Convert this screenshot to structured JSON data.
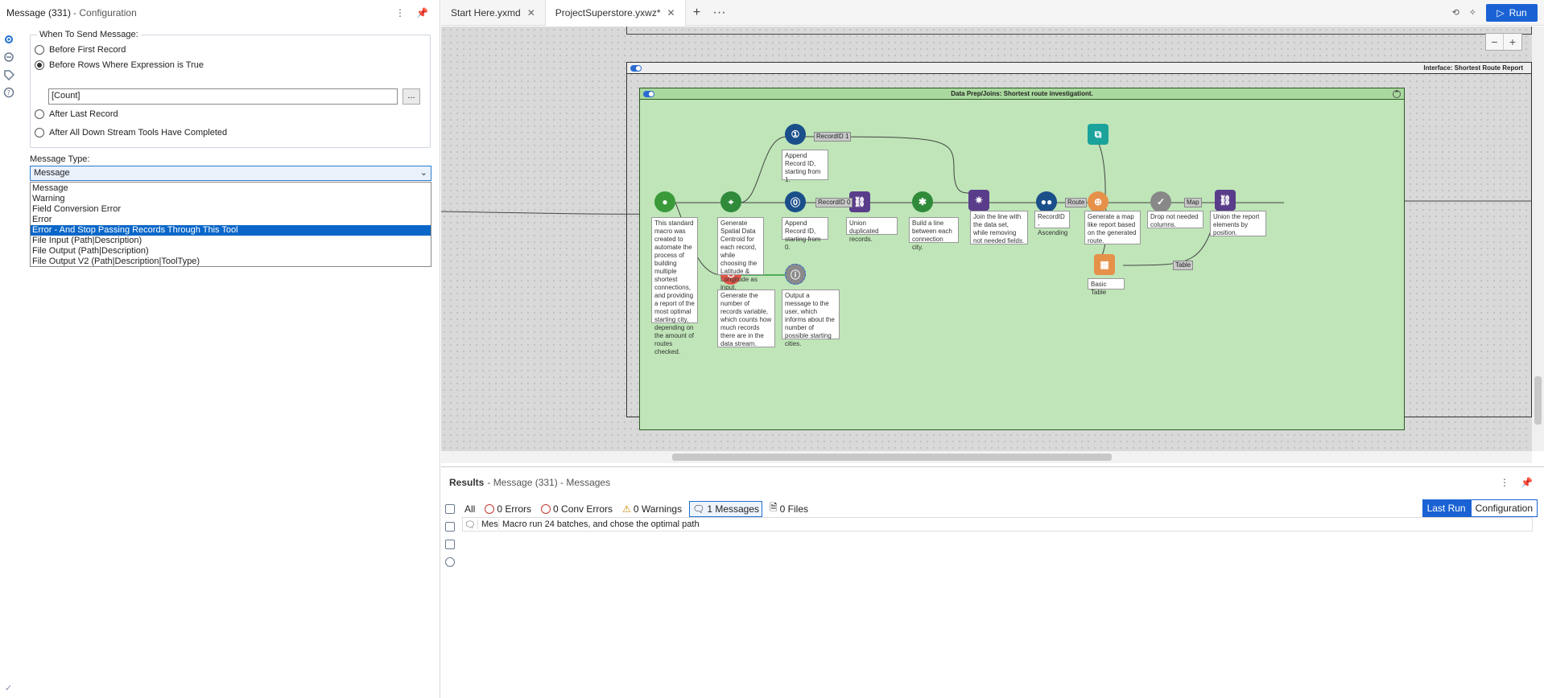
{
  "config_panel": {
    "title": "Message (331)",
    "subtitle": "- Configuration",
    "when_group_label": "When To Send Message:",
    "radio_options": [
      {
        "label": "Before First Record",
        "selected": false
      },
      {
        "label": "Before Rows Where Expression is True",
        "selected": true
      },
      {
        "label": "After Last Record",
        "selected": false
      },
      {
        "label": "After All Down Stream Tools Have Completed",
        "selected": false
      }
    ],
    "expression_value": "[Count]",
    "expression_button": "...",
    "message_type_label": "Message Type:",
    "message_type_selected": "Message",
    "message_type_options": [
      "Message",
      "Warning",
      "Field Conversion Error",
      "Error",
      "Error - And Stop Passing Records Through This Tool",
      "File Input (Path|Description)",
      "File Output (Path|Description)",
      "File Output V2 (Path|Description|ToolType)"
    ],
    "highlighted_option_index": 4
  },
  "tabs": [
    {
      "label": "Start Here.yxmd",
      "active": false
    },
    {
      "label": "ProjectSuperstore.yxwz*",
      "active": true
    }
  ],
  "toolbar": {
    "add_tab": "+",
    "more": "···",
    "run_label": "Run"
  },
  "canvas": {
    "interface_title": "Interface: Shortest Route Report",
    "container_title": "Data Prep/Joins: Shortest route investigationt.",
    "connection_labels": {
      "record_id_1": "RecordID 1",
      "record_id_0": "RecordID 0",
      "route": "Route",
      "map": "Map",
      "table": "Table"
    },
    "annotations": {
      "macro": "This standard macro was created to automate the process of building multiple shortest connections, and providing a report of the most optimal starting city, depending on the amount of routes checked.",
      "spatial": "Generate Spatial Data Centroid for each record, while choosing the Latitude & Longitude as input.",
      "append1": "Append Record ID, starting from 1.",
      "append0": "Append Record ID, starting from 0.",
      "union_dup": "Union duplicated records.",
      "build_line": "Build a line between each connection city.",
      "join": "Join the line with the data set, while removing not needed fields.",
      "sort": "RecordID - Ascending",
      "map": "Generate a map like report based on the generated route.",
      "drop": "Drop not needed columns.",
      "union_report": "Union the report elements by position.",
      "basic_table": "Basic Table",
      "count": "Generate the number of records variable, which counts how much records there are in the data stream.",
      "message": "Output a message to the user, which informs about the number of possible starting cities."
    },
    "zoom_out": "−",
    "zoom_in": "+"
  },
  "results": {
    "title": "Results",
    "subtitle": "- Message (331) - Messages",
    "filters": {
      "all": "All",
      "errors": "0 Errors",
      "conv_errors": "0 Conv Errors",
      "warnings": "0 Warnings",
      "messages": "1 Messages",
      "files": "0 Files"
    },
    "last_run": "Last Run",
    "configuration": "Configuration",
    "row": {
      "tool": "Mes",
      "message": "Macro run 24 batches, and chose the optimal path"
    }
  },
  "colors": {
    "accent": "#1a62d4",
    "container_fill": "#bfe5b8",
    "canvas": "#d9d9d9"
  }
}
